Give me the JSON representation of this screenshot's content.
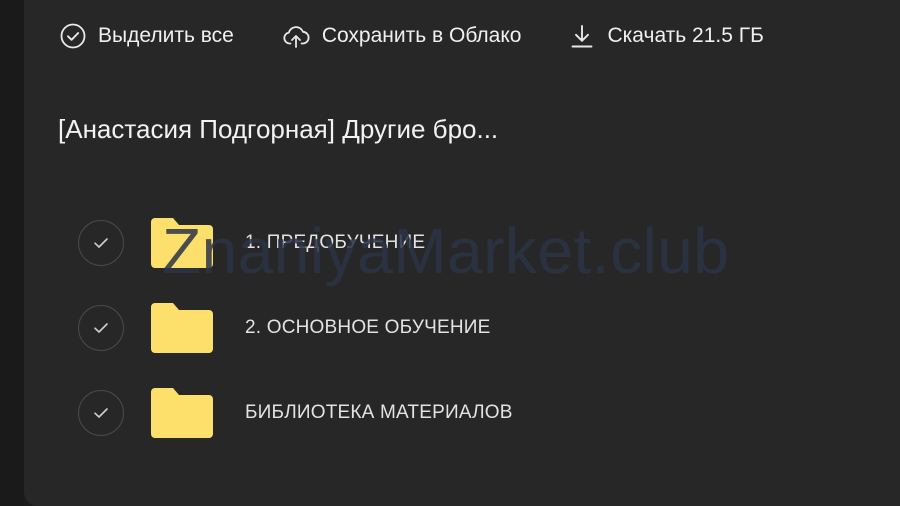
{
  "toolbar": {
    "select_all_label": "Выделить все",
    "save_cloud_label": "Сохранить в Облако",
    "download_label": "Скачать 21.5 ГБ"
  },
  "folder": {
    "title": "[Анастасия Подгорная] Другие бро..."
  },
  "items": [
    {
      "label": "1. ПРЕДОБУЧЕНИЕ"
    },
    {
      "label": "2. ОСНОВНОЕ ОБУЧЕНИЕ"
    },
    {
      "label": "БИБЛИОТЕКА МАТЕРИАЛОВ"
    }
  ],
  "watermark": {
    "text": "ZnaniyaMarket.club"
  },
  "colors": {
    "background": "#272727",
    "folder_yellow": "#fddf6b",
    "text": "#f0f0f0"
  },
  "icons": {
    "select_all": "check-circle-icon",
    "save_cloud": "cloud-upload-icon",
    "download": "download-icon",
    "folder": "folder-icon"
  }
}
